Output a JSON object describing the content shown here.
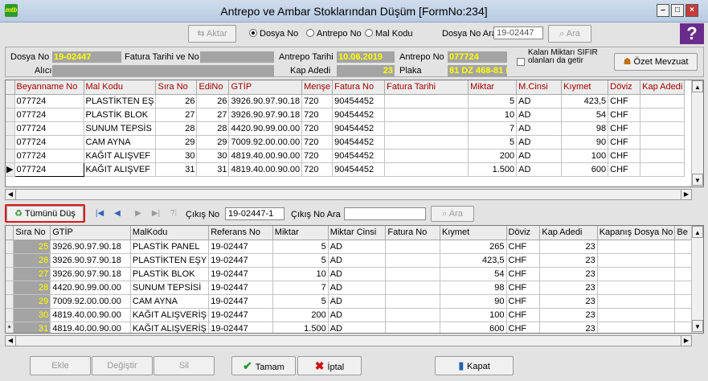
{
  "window": {
    "title": "Antrepo ve Ambar Stoklarından Düşüm [FormNo:234]",
    "app_icon_text": "mtb"
  },
  "toolbar": {
    "aktar_label": "Aktar",
    "radio_dosya": "Dosya No",
    "radio_antrepo": "Antrepo No",
    "radio_mal": "Mal Kodu",
    "search_label": "Dosya No Ara",
    "search_value": "19-02447",
    "ara_label": "Ara"
  },
  "header": {
    "dosya_no_label": "Dosya No",
    "dosya_no_value": "19-02447",
    "fatura_label": "Fatura Tarihi ve No",
    "fatura_value": "",
    "antrepo_tarihi_label": "Antrepo Tarihi",
    "antrepo_tarihi_value": "10.06.2019",
    "antrepo_no_label": "Antrepo No",
    "antrepo_no_value": "077724",
    "alici_label": "Alıcı",
    "alici_value": "",
    "kap_adedi_label": "Kap Adedi",
    "kap_adedi_value": "23",
    "plaka_label": "Plaka",
    "plaka_value": "81 DZ 468-81 D",
    "kalan_label": "Kalan Miktarı SIFIR olanları da getir",
    "ozet_label": "Özet Mevzuat"
  },
  "top_grid": {
    "columns": [
      "Beyanname No",
      "Mal Kodu",
      "Sıra No",
      "EdiNo",
      "GTİP",
      "Menşe",
      "Fatura No",
      "Fatura Tarihi",
      "Miktar",
      "M.Cinsi",
      "Kıymet",
      "Döviz",
      "Kap Adedi"
    ],
    "rows": [
      [
        "077724",
        "PLASTİKTEN EŞ",
        "26",
        "26",
        "3926.90.97.90.18",
        "720",
        "90454452",
        "",
        "5",
        "AD",
        "423,5",
        "CHF",
        ""
      ],
      [
        "077724",
        "PLASTİK BLOK",
        "27",
        "27",
        "3926.90.97.90.18",
        "720",
        "90454452",
        "",
        "10",
        "AD",
        "54",
        "CHF",
        ""
      ],
      [
        "077724",
        "SUNUM TEPSİS",
        "28",
        "28",
        "4420.90.99.00.00",
        "720",
        "90454452",
        "",
        "7",
        "AD",
        "98",
        "CHF",
        ""
      ],
      [
        "077724",
        "CAM AYNA",
        "29",
        "29",
        "7009.92.00.00.00",
        "720",
        "90454452",
        "",
        "5",
        "AD",
        "90",
        "CHF",
        ""
      ],
      [
        "077724",
        "KAĞIT ALIŞVEF",
        "30",
        "30",
        "4819.40.00.90.00",
        "720",
        "90454452",
        "",
        "200",
        "AD",
        "100",
        "CHF",
        ""
      ],
      [
        "077724",
        "KAĞIT ALIŞVEF",
        "31",
        "31",
        "4819.40.00.90.00",
        "720",
        "90454452",
        "",
        "1.500",
        "AD",
        "600",
        "CHF",
        ""
      ]
    ]
  },
  "midbar": {
    "tumunu_dus_label": "Tümünü Düş",
    "cikis_no_label": "Çıkış No",
    "cikis_no_value": "19-02447-1",
    "cikis_ara_label": "Çıkış No Ara",
    "cikis_ara_value": "",
    "ara_label": "Ara"
  },
  "bottom_grid": {
    "columns": [
      "Sıra No",
      "GTİP",
      "MalKodu",
      "Referans No",
      "Miktar",
      "Miktar Cinsi",
      "Fatura No",
      "Kıymet",
      "Döviz",
      "Kap Adedi",
      "Kapanış Dosya No",
      "Be"
    ],
    "rows": [
      [
        "25",
        "3926.90.97.90.18",
        "PLASTİK PANEL",
        "19-02447",
        "5",
        "AD",
        "",
        "265",
        "CHF",
        "23",
        "",
        ""
      ],
      [
        "26",
        "3926.90.97.90.18",
        "PLASTİKTEN EŞY",
        "19-02447",
        "5",
        "AD",
        "",
        "423,5",
        "CHF",
        "23",
        "",
        ""
      ],
      [
        "27",
        "3926.90.97.90.18",
        "PLASTİK BLOK",
        "19-02447",
        "10",
        "AD",
        "",
        "54",
        "CHF",
        "23",
        "",
        ""
      ],
      [
        "28",
        "4420.90.99.00.00",
        "SUNUM TEPSİSİ",
        "19-02447",
        "7",
        "AD",
        "",
        "98",
        "CHF",
        "23",
        "",
        ""
      ],
      [
        "29",
        "7009.92.00.00.00",
        "CAM AYNA",
        "19-02447",
        "5",
        "AD",
        "",
        "90",
        "CHF",
        "23",
        "",
        ""
      ],
      [
        "30",
        "4819.40.00.90.00",
        "KAĞIT ALIŞVERİŞ",
        "19-02447",
        "200",
        "AD",
        "",
        "100",
        "CHF",
        "23",
        "",
        ""
      ],
      [
        "31",
        "4819.40.00.90.00",
        "KAĞIT ALIŞVERİŞ",
        "19-02447",
        "1.500",
        "AD",
        "",
        "600",
        "CHF",
        "23",
        "",
        ""
      ]
    ]
  },
  "footer": {
    "ekle_label": "Ekle",
    "degistir_label": "Değiştir",
    "sil_label": "Sil",
    "tamam_label": "Tamam",
    "iptal_label": "İptal",
    "kapat_label": "Kapat"
  },
  "colors": {
    "accent_field": "#a4a4a4",
    "field_text": "#ffff00",
    "highlight": "#e01515",
    "header_text": "#a00000"
  }
}
